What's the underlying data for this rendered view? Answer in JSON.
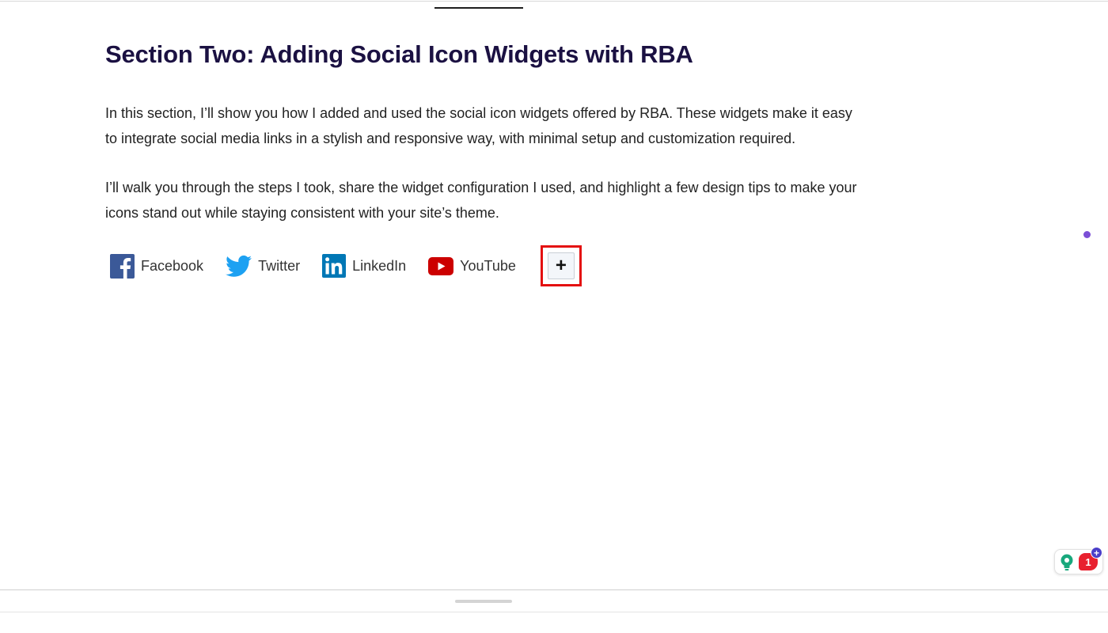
{
  "article": {
    "heading": "Section Two: Adding Social Icon Widgets with RBA",
    "paragraph_1": "In this section, I’ll show you how I added and used the social icon widgets offered by RBA. These widgets make it easy to integrate social media links in a stylish and responsive way, with minimal setup and customization required.",
    "paragraph_2": "I’ll walk you through the steps I took, share the widget configuration I used, and highlight a few design tips to make your icons stand out while staying consistent with your site’s theme."
  },
  "social_icons": [
    {
      "label": "Facebook",
      "icon": "facebook-icon",
      "color": "#3b5998"
    },
    {
      "label": "Twitter",
      "icon": "twitter-icon",
      "color": "#1da1f2"
    },
    {
      "label": "LinkedIn",
      "icon": "linkedin-icon",
      "color": "#0077b5"
    },
    {
      "label": "YouTube",
      "icon": "youtube-icon",
      "color": "#cc0000"
    }
  ],
  "add_button": {
    "label": "+",
    "highlight_color": "#e41010"
  },
  "floating_widget": {
    "badge_count": "1",
    "plus_label": "+"
  },
  "colors": {
    "heading": "#1b1142",
    "body_text": "#222222",
    "accent_dot": "#7b4fd6"
  }
}
